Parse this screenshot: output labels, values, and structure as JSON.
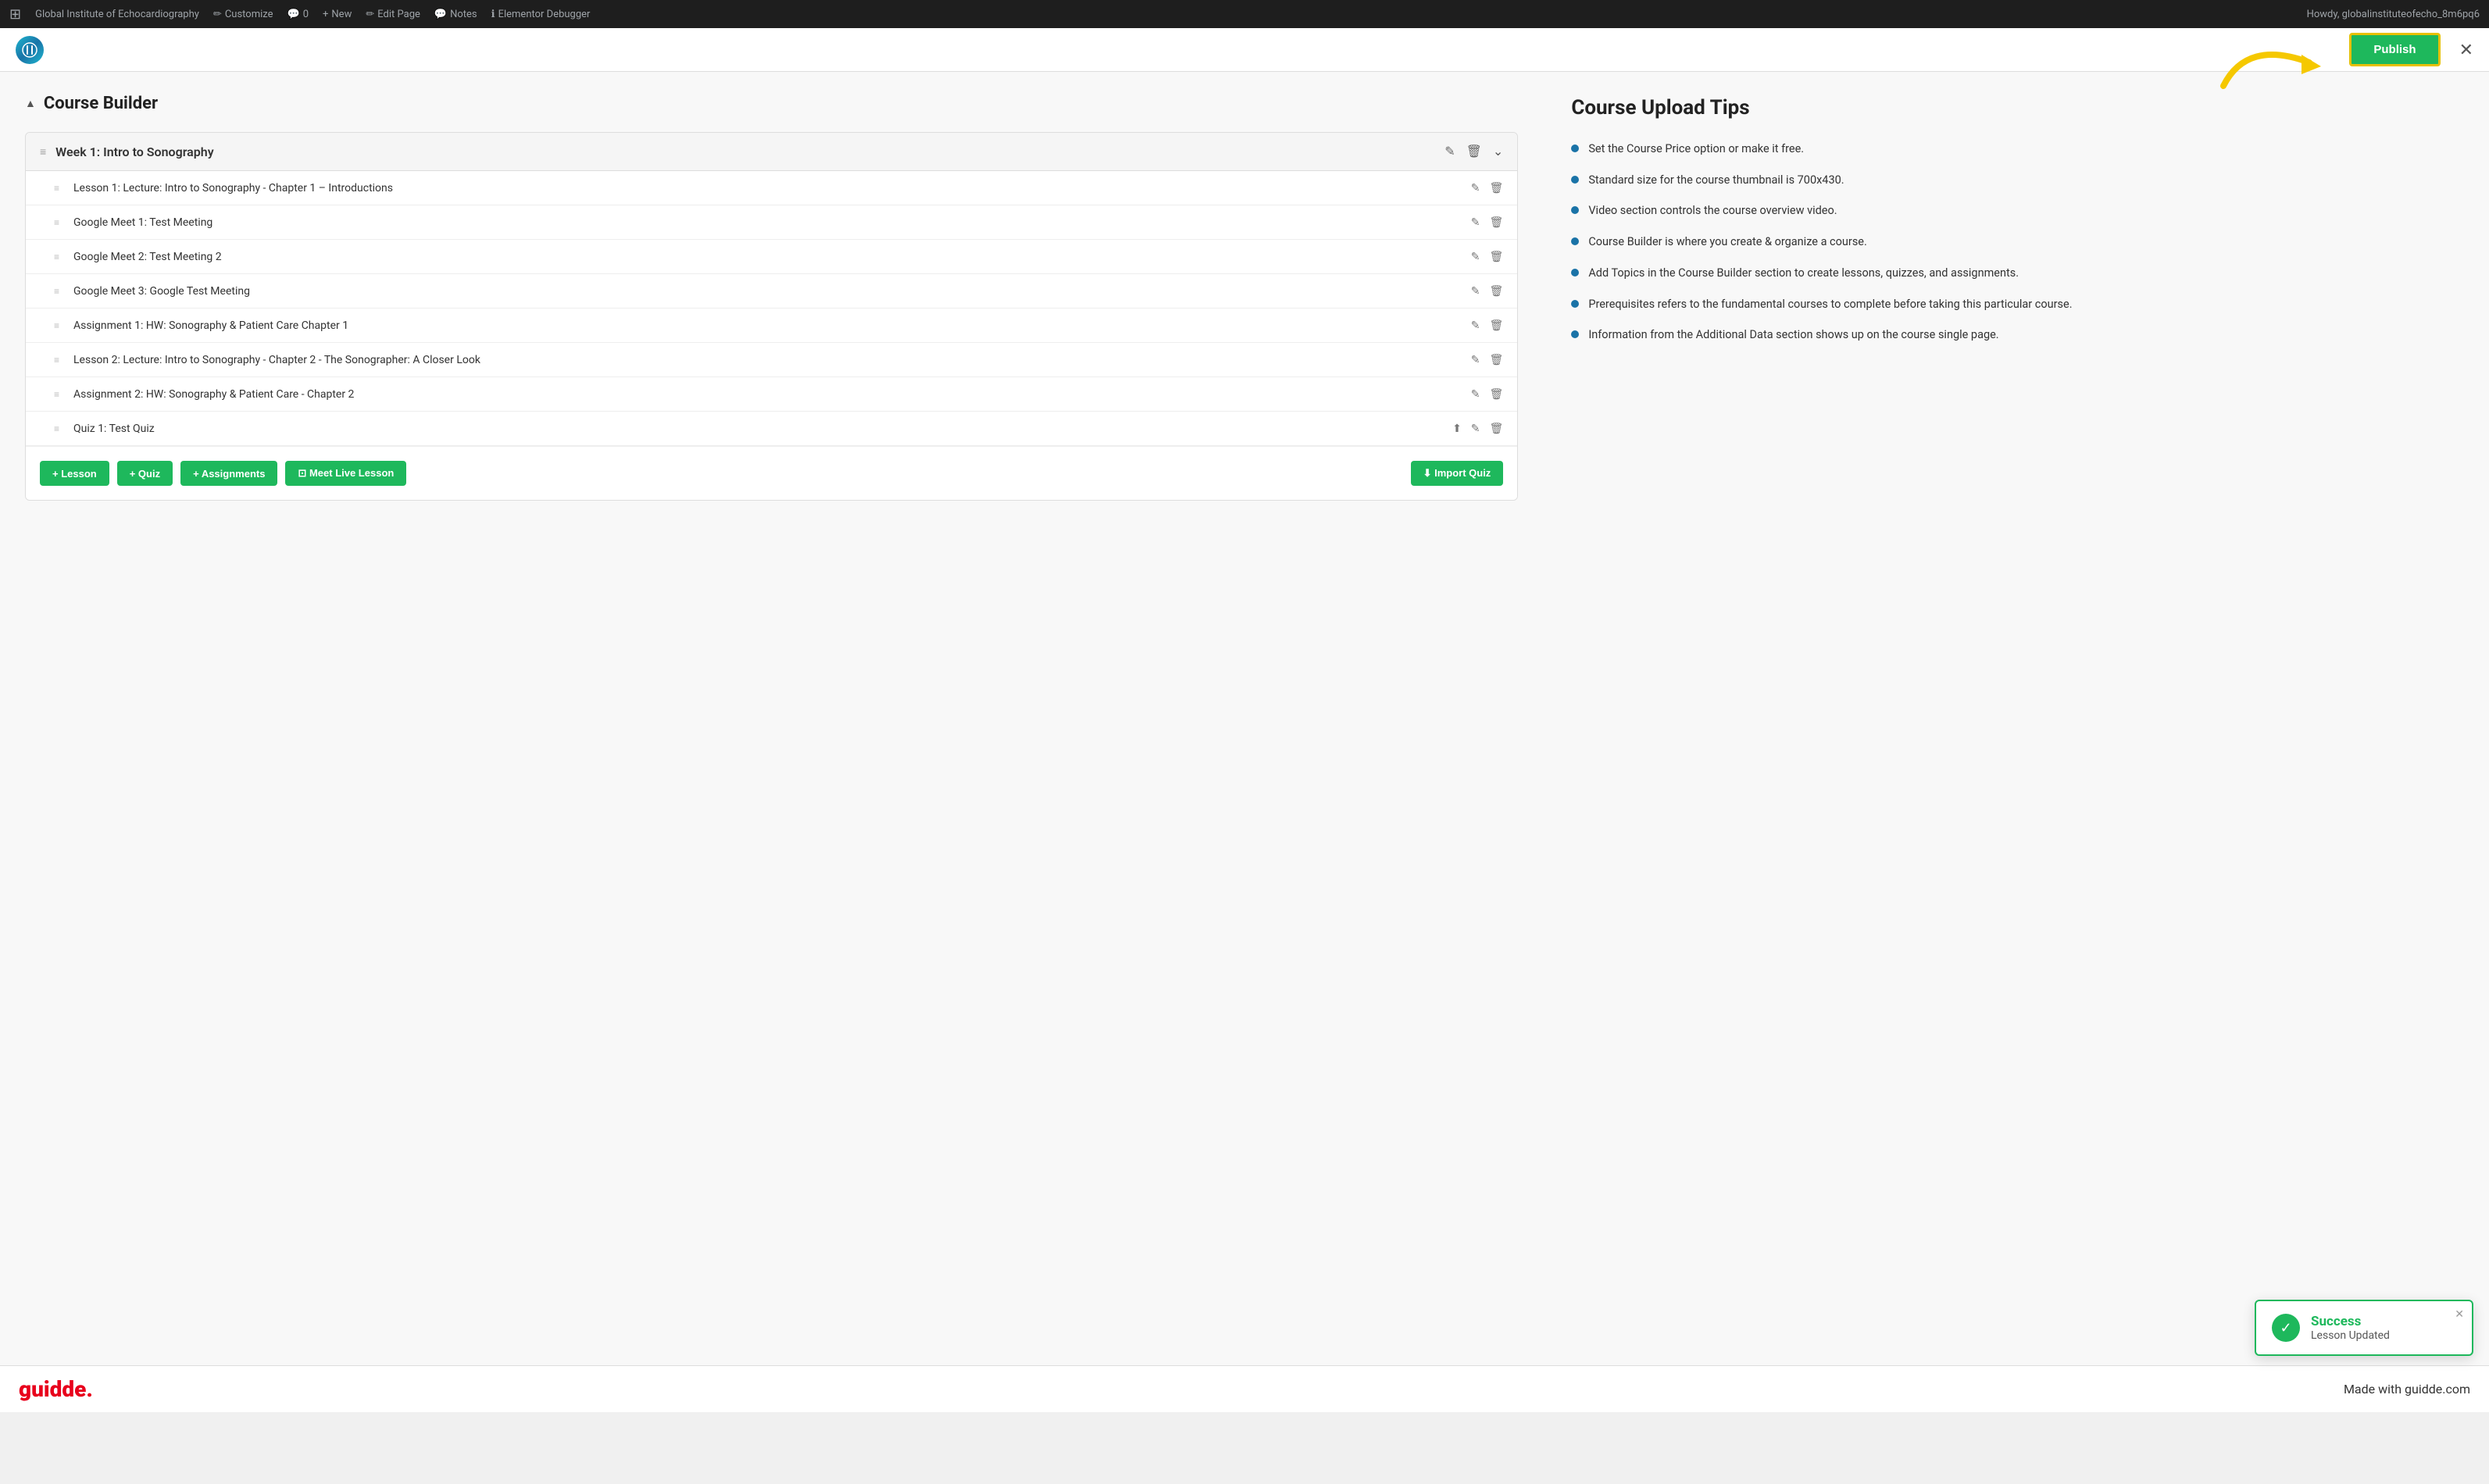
{
  "adminBar": {
    "wpLogo": "⊞",
    "siteName": "Global Institute of Echocardiography",
    "customize": "Customize",
    "comments": "0",
    "new": "New",
    "editPage": "Edit Page",
    "notes": "Notes",
    "elementorDebugger": "Elementor Debugger",
    "howdy": "Howdy, globalinstituteofecho_8m6pq6"
  },
  "toolbar": {
    "publishLabel": "Publish",
    "closeLabel": "✕"
  },
  "courseBuilder": {
    "title": "Course Builder",
    "topic": {
      "title": "Week 1: Intro to Sonography"
    },
    "lessons": [
      {
        "title": "Lesson 1: Lecture: Intro to Sonography - Chapter 1 – Introductions"
      },
      {
        "title": "Google Meet 1: Test Meeting"
      },
      {
        "title": "Google Meet 2: Test Meeting 2"
      },
      {
        "title": "Google Meet 3: Google Test Meeting"
      },
      {
        "title": "Assignment 1: HW: Sonography & Patient Care Chapter 1"
      },
      {
        "title": "Lesson 2: Lecture: Intro to Sonography - Chapter 2 - The Sonographer: A Closer Look"
      },
      {
        "title": "Assignment 2: HW: Sonography & Patient Care - Chapter 2"
      },
      {
        "title": "Quiz 1: Test Quiz"
      }
    ],
    "buttons": {
      "lesson": "+ Lesson",
      "quiz": "+ Quiz",
      "assignments": "+ Assignments",
      "meetLiveLesson": "⊡ Meet Live Lesson",
      "importQuiz": "⬇ Import Quiz"
    }
  },
  "tips": {
    "title": "Course Upload Tips",
    "items": [
      "Set the Course Price option or make it free.",
      "Standard size for the course thumbnail is 700x430.",
      "Video section controls the course overview video.",
      "Course Builder is where you create & organize a course.",
      "Add Topics in the Course Builder section to create lessons, quizzes, and assignments.",
      "Prerequisites refers to the fundamental courses to complete before taking this particular course.",
      "Information from the Additional Data section shows up on the course single page."
    ]
  },
  "toast": {
    "title": "Success",
    "subtitle": "Lesson Updated"
  },
  "guiddeBar": {
    "logo": "guidde.",
    "madeWith": "Made with guidde.com"
  }
}
